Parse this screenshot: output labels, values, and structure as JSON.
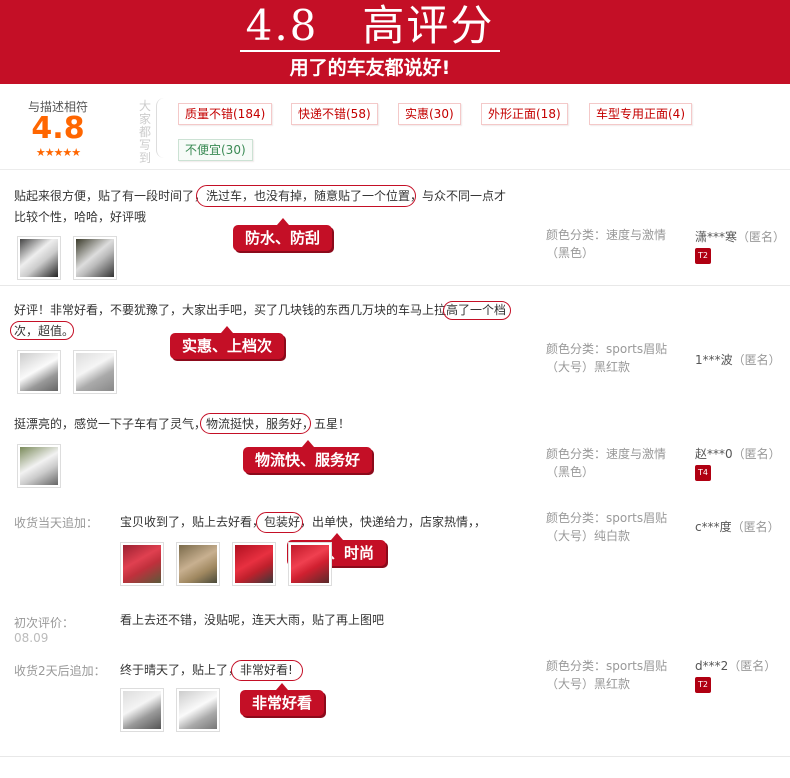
{
  "banner": {
    "rating": "4.8　高评分",
    "tagline": "用了的车友都说好!"
  },
  "summary": {
    "label": "与描述相符",
    "score": "4.8",
    "stars": "★★★★★",
    "prompt": "大家都写到",
    "tags": [
      {
        "text": "质量不错(184)"
      },
      {
        "text": "快递不错(58)"
      },
      {
        "text": "实惠(30)"
      },
      {
        "text": "外形正面(18)"
      },
      {
        "text": "车型专用正面(4)"
      },
      {
        "text": "不便宜(30)"
      }
    ]
  },
  "reviews": [
    {
      "text_line1": "贴起来很方便，贴了有一段时间了，洗过车，也没有掉，随意贴了一个位置，与众不同一点才",
      "text_line2": "比较个性，哈哈，好评哦",
      "callout": "防水、防刮",
      "sku_line1": "颜色分类：速度与激情",
      "sku_line2": "（黑色）",
      "user": "潇***寒",
      "anon": "（匿名）",
      "level": "T2"
    },
    {
      "text_line1": "好评！非常好看，不要犹豫了，大家出手吧，买了几块钱的东西几万块的车马上拉高了一个档",
      "text_line2": "次，超值。",
      "callout": "实惠、上档次",
      "sku_line1": "颜色分类：sports眉贴",
      "sku_line2": "（大号）黑红款",
      "user": "1***波",
      "anon": "（匿名）"
    },
    {
      "text_line1": "挺漂亮的，感觉一下子车有了灵气，物流挺快，服务好，五星！",
      "callout": "物流快、服务好",
      "sku_line1": "颜色分类：速度与激情",
      "sku_line2": "（黑色）",
      "user": "赵***0",
      "anon": "（匿名）",
      "level": "T4"
    },
    {
      "append_label": "收货当天追加：",
      "text_line1": "宝贝收到了，贴上去好看，包装好，出单快，快递给力，店家热情，，",
      "callout": "美观、时尚",
      "sku_line1": "颜色分类：sports眉贴",
      "sku_line2": "（大号）纯白款",
      "user": "c***度",
      "anon": "（匿名）",
      "initial_label": "初次评价：",
      "initial_date": "08.09",
      "initial_text": "看上去还不错，没贴呢，连天大雨，贴了再上图吧"
    },
    {
      "append_label": "收货2天后追加：",
      "text_line1": "终于晴天了，贴上了，非常好看!",
      "callout": "非常好看",
      "sku_line1": "颜色分类：sports眉贴",
      "sku_line2": "（大号）黑红款",
      "user": "d***2",
      "anon": "（匿名）",
      "level": "T2"
    }
  ],
  "colors": {
    "brand_red": "#c40f26",
    "score_orange": "#ff6600",
    "positive_tag": "#c40000",
    "negative_tag": "#3a8a54"
  }
}
